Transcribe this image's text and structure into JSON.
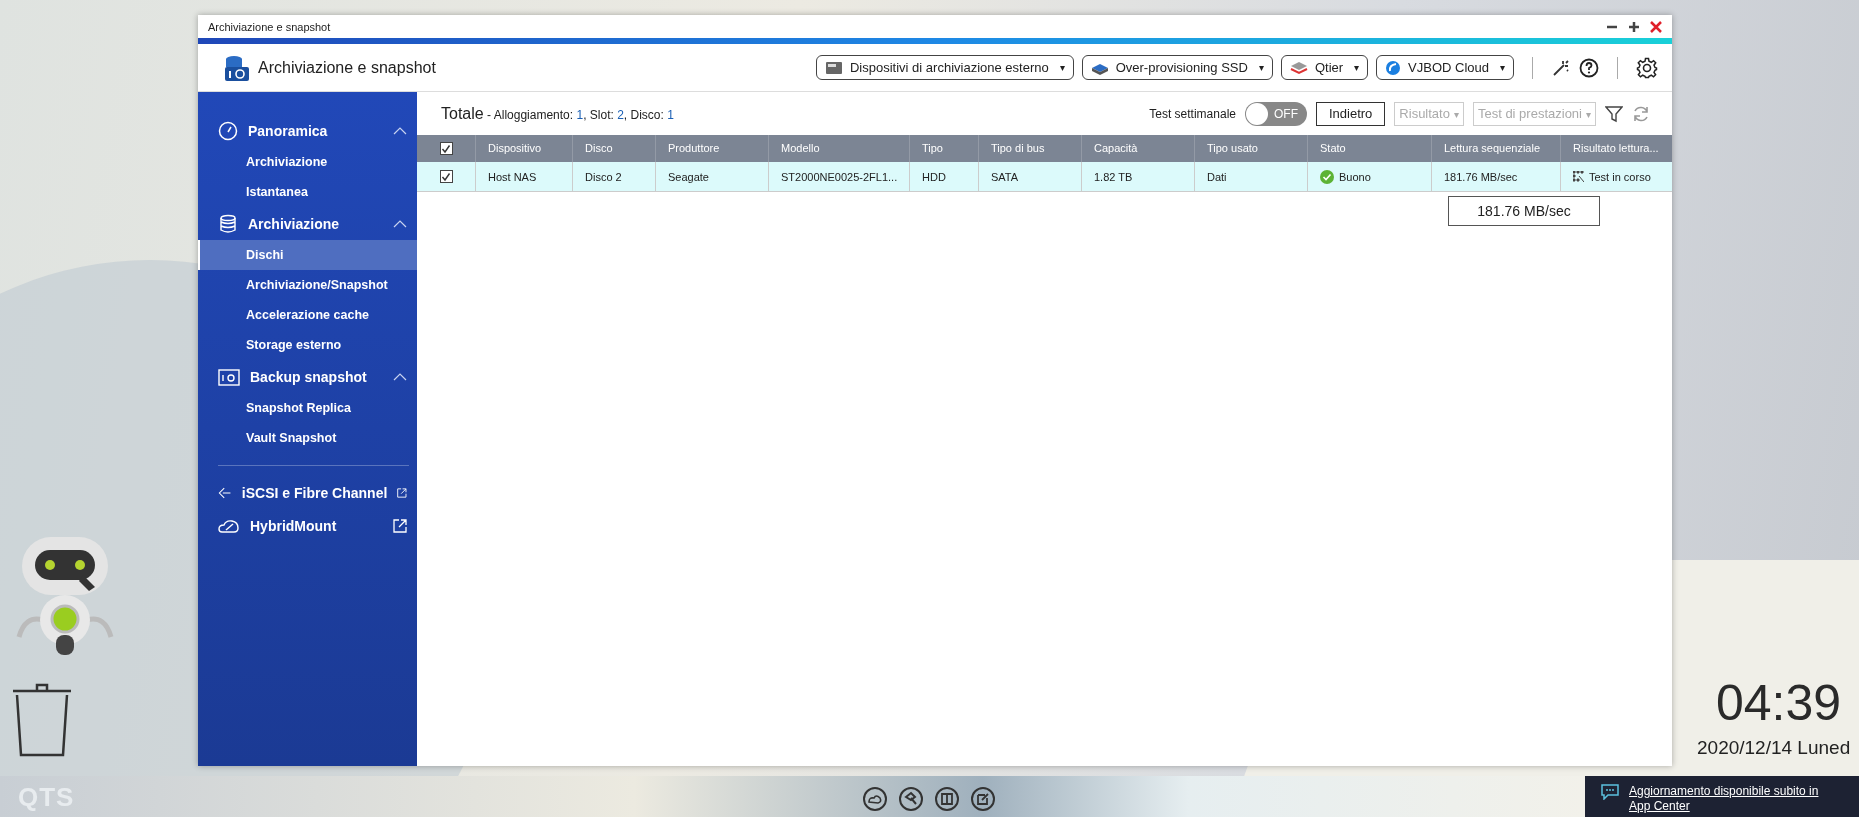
{
  "window": {
    "title": "Archiviazione e snapshot",
    "app_title": "Archiviazione e snapshot"
  },
  "header_buttons": [
    {
      "label": "Dispositivi di archiviazione esterno",
      "caret": "▾"
    },
    {
      "label": "Over-provisioning SSD",
      "caret": "▾"
    },
    {
      "label": "Qtier",
      "caret": "▾"
    },
    {
      "label": "VJBOD Cloud",
      "caret": "▾"
    }
  ],
  "sidebar": {
    "groups": [
      {
        "kind": "group",
        "label": "Panoramica",
        "expanded": true,
        "children": [
          {
            "label": "Archiviazione",
            "selected": false
          },
          {
            "label": "Istantanea",
            "selected": false
          }
        ]
      },
      {
        "kind": "group",
        "label": "Archiviazione",
        "expanded": true,
        "children": [
          {
            "label": "Dischi",
            "selected": true
          },
          {
            "label": "Archiviazione/Snapshot",
            "selected": false
          },
          {
            "label": "Accelerazione cache",
            "selected": false
          },
          {
            "label": "Storage esterno",
            "selected": false
          }
        ]
      },
      {
        "kind": "group",
        "label": "Backup snapshot",
        "expanded": true,
        "children": [
          {
            "label": "Snapshot Replica",
            "selected": false
          },
          {
            "label": "Vault Snapshot",
            "selected": false
          }
        ]
      },
      {
        "kind": "link",
        "label": "iSCSI e Fibre Channel"
      },
      {
        "kind": "link",
        "label": "HybridMount"
      }
    ]
  },
  "toolbar": {
    "title": "Totale",
    "separator": "-",
    "summary": [
      {
        "label": "Alloggiamento:",
        "value": "1",
        "sep": ","
      },
      {
        "label": "Slot:",
        "value": "2",
        "sep": ","
      },
      {
        "label": "Disco:",
        "value": "1"
      }
    ],
    "weekly_test": {
      "label": "Test settimanale",
      "on": false,
      "state_text": "OFF"
    },
    "buttons": [
      {
        "label": "Indietro",
        "disabled": false
      },
      {
        "label": "Risultato",
        "disabled": true,
        "caret": "▾"
      },
      {
        "label": "Test di prestazioni",
        "disabled": true,
        "caret": "▾"
      }
    ]
  },
  "table": {
    "all_checked": true,
    "columns": [
      "Dispositivo",
      "Disco",
      "Produttore",
      "Modello",
      "Tipo",
      "Tipo di bus",
      "Capacità",
      "Tipo usato",
      "Stato",
      "Lettura sequenziale",
      "Risultato lettura..."
    ],
    "rows": [
      {
        "selected": true,
        "checked": true,
        "cells": [
          "Host NAS",
          "Disco 2",
          "Seagate",
          "ST2000NE0025-2FL1...",
          "HDD",
          "SATA",
          "1.82 TB",
          "Dati",
          "Buono",
          "181.76 MB/sec",
          "Test in corso"
        ],
        "healthy": true
      }
    ]
  },
  "tooltip": "181.76 MB/sec",
  "desktop": {
    "clock": "04:39",
    "date": "2020/12/14 Luned",
    "logo": "QTS"
  },
  "notification": {
    "text": "Aggiornamento disponibile subito in App Center"
  }
}
